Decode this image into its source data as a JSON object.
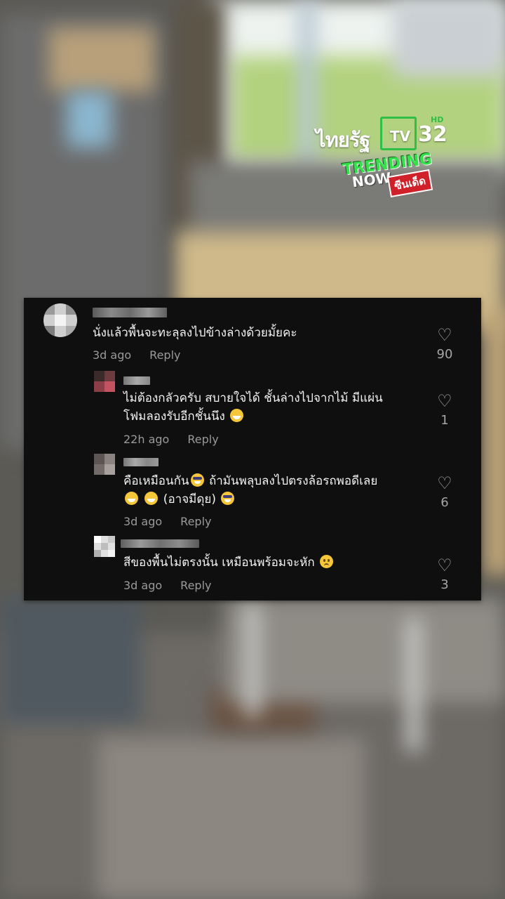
{
  "overlay": {
    "channel_logo": {
      "thai_text": "ไทยรัฐ",
      "tv_text": "TV",
      "channel_number": "32",
      "hd_badge": "HD"
    },
    "trending_badge": {
      "line1": "TRENDING",
      "line2": "NOW",
      "tag": "ซีนเด็ด"
    }
  },
  "comments": [
    {
      "text": "นั่งแล้วพื้นจะทะลุลงไปข้างล่างด้วยมั้ยคะ",
      "time": "3d ago",
      "reply_label": "Reply",
      "likes": "90"
    },
    {
      "text_line1": "ไม่ต้องกลัวครับ สบายใจได้ ชั้นล่างไปจากไม้ มีแผ่น",
      "text_line2": "โฟมลองรับอีกชั้นนึง",
      "emoji": "grinning-face",
      "time": "22h ago",
      "reply_label": "Reply",
      "likes": "1"
    },
    {
      "text_part1": "คือเหมือนกัน",
      "text_part2": " ถ้ามันพลุบลงไปตรงล้อรถพอดีเลย",
      "text_part3": " (อาจมีดุย)",
      "emojis": [
        "smiling-face-with-sunglasses",
        "grinning-face",
        "grinning-face",
        "smiling-face-with-sunglasses"
      ],
      "time": "3d ago",
      "reply_label": "Reply",
      "likes": "6"
    },
    {
      "text": "สีของพื้นไม่ตรงนั้น เหมือนพร้อมจะหัก",
      "emoji": "pleading-face",
      "time": "3d ago",
      "reply_label": "Reply",
      "likes": "3"
    }
  ],
  "colors": {
    "panel_bg": "#0f0f0f",
    "meta_text": "#9a9a9a",
    "logo_green": "#2fbf47",
    "trending_red": "#d0202a"
  }
}
